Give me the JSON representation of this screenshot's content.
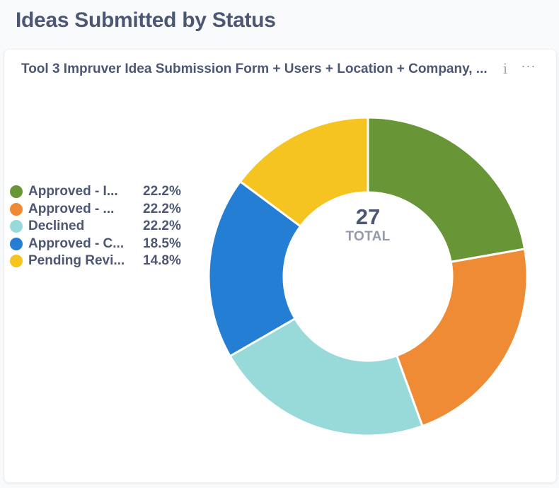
{
  "dashboard": {
    "title": "Ideas Submitted by Status"
  },
  "card": {
    "title": "Tool 3 Impruver Idea Submission Form + Users + Location + Company, ...",
    "info_icon": "info-icon",
    "more_icon": "more-icon"
  },
  "chart_data": {
    "type": "pie",
    "total_value": "27",
    "total_label": "TOTAL",
    "legend_placement": "left",
    "slices": [
      {
        "label": "Approved - I...",
        "percent": "22.2%",
        "value": 22.2,
        "color": "#689636"
      },
      {
        "label": "Approved - ...",
        "percent": "22.2%",
        "value": 22.2,
        "color": "#f08b35"
      },
      {
        "label": "Declined",
        "percent": "22.2%",
        "value": 22.2,
        "color": "#98dada"
      },
      {
        "label": "Approved - C...",
        "percent": "18.5%",
        "value": 18.5,
        "color": "#237ed4"
      },
      {
        "label": "Pending Revi...",
        "percent": "14.8%",
        "value": 14.8,
        "color": "#f5c420"
      }
    ]
  }
}
